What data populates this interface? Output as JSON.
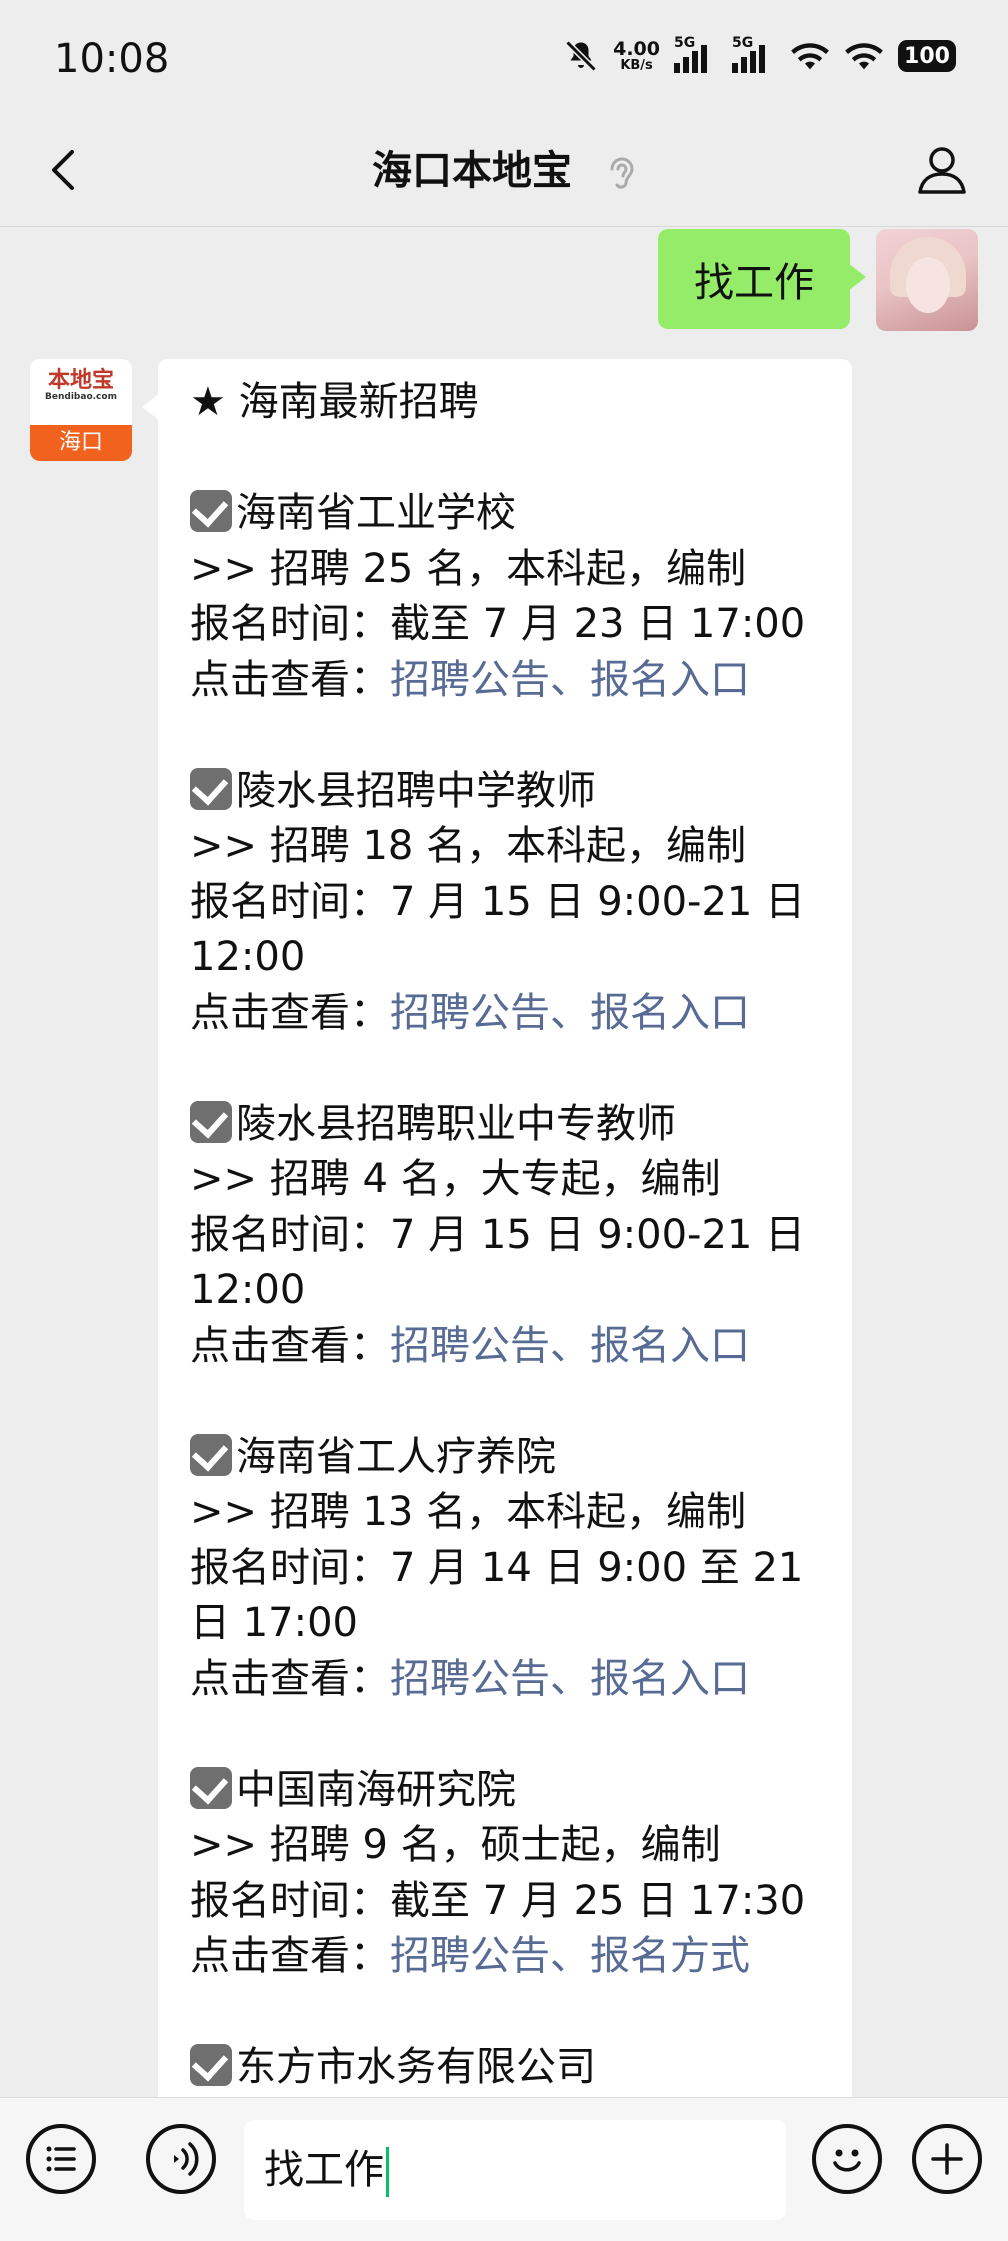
{
  "status_bar": {
    "time": "10:08",
    "net_speed_value": "4.00",
    "net_speed_unit": "KB/s",
    "sim1_label": "5G",
    "sim2_label": "5G",
    "battery": "100"
  },
  "header": {
    "title": "海口本地宝"
  },
  "chat": {
    "my_message": "找工作",
    "bot_avatar": {
      "logo_text": "本地宝",
      "logo_sub": "Bendibao.com",
      "city": "海口"
    },
    "reply": {
      "heading": "★ 海南最新招聘",
      "entries": [
        {
          "name": "海南省工业学校",
          "detail": ">> 招聘 25 名，本科起，编制",
          "time": "报名时间：截至 7 月 23 日 17:00",
          "view_label": "点击查看：",
          "links": "招聘公告、报名入口"
        },
        {
          "name": "陵水县招聘中学教师",
          "detail": ">> 招聘 18 名，本科起，编制",
          "time": "报名时间：7 月 15 日 9:00-21 日 12:00",
          "view_label": "点击查看：",
          "links": "招聘公告、报名入口"
        },
        {
          "name": "陵水县招聘职业中专教师",
          "detail": ">> 招聘 4 名，大专起，编制",
          "time": "报名时间：7 月 15 日 9:00-21 日 12:00",
          "view_label": "点击查看：",
          "links": "招聘公告、报名入口"
        },
        {
          "name": "海南省工人疗养院",
          "detail": ">> 招聘 13 名，本科起，编制",
          "time": "报名时间：7 月 14 日 9:00 至 21 日 17:00",
          "view_label": "点击查看：",
          "links": "招聘公告、报名入口"
        },
        {
          "name": "中国南海研究院",
          "detail": ">> 招聘 9 名，硕士起，编制",
          "time": "报名时间：截至 7 月 25 日 17:30",
          "view_label": "点击查看：",
          "links": "招聘公告、报名方式"
        },
        {
          "name": "东方市水务有限公司"
        }
      ]
    }
  },
  "input_bar": {
    "value": "找工作",
    "icons": [
      "menu-list-icon",
      "voice-icon",
      "emoji-icon",
      "plus-icon"
    ]
  },
  "colors": {
    "my_bubble": "#95ec69",
    "link": "#576b95",
    "background": "#ededed",
    "caret": "#07c160"
  }
}
